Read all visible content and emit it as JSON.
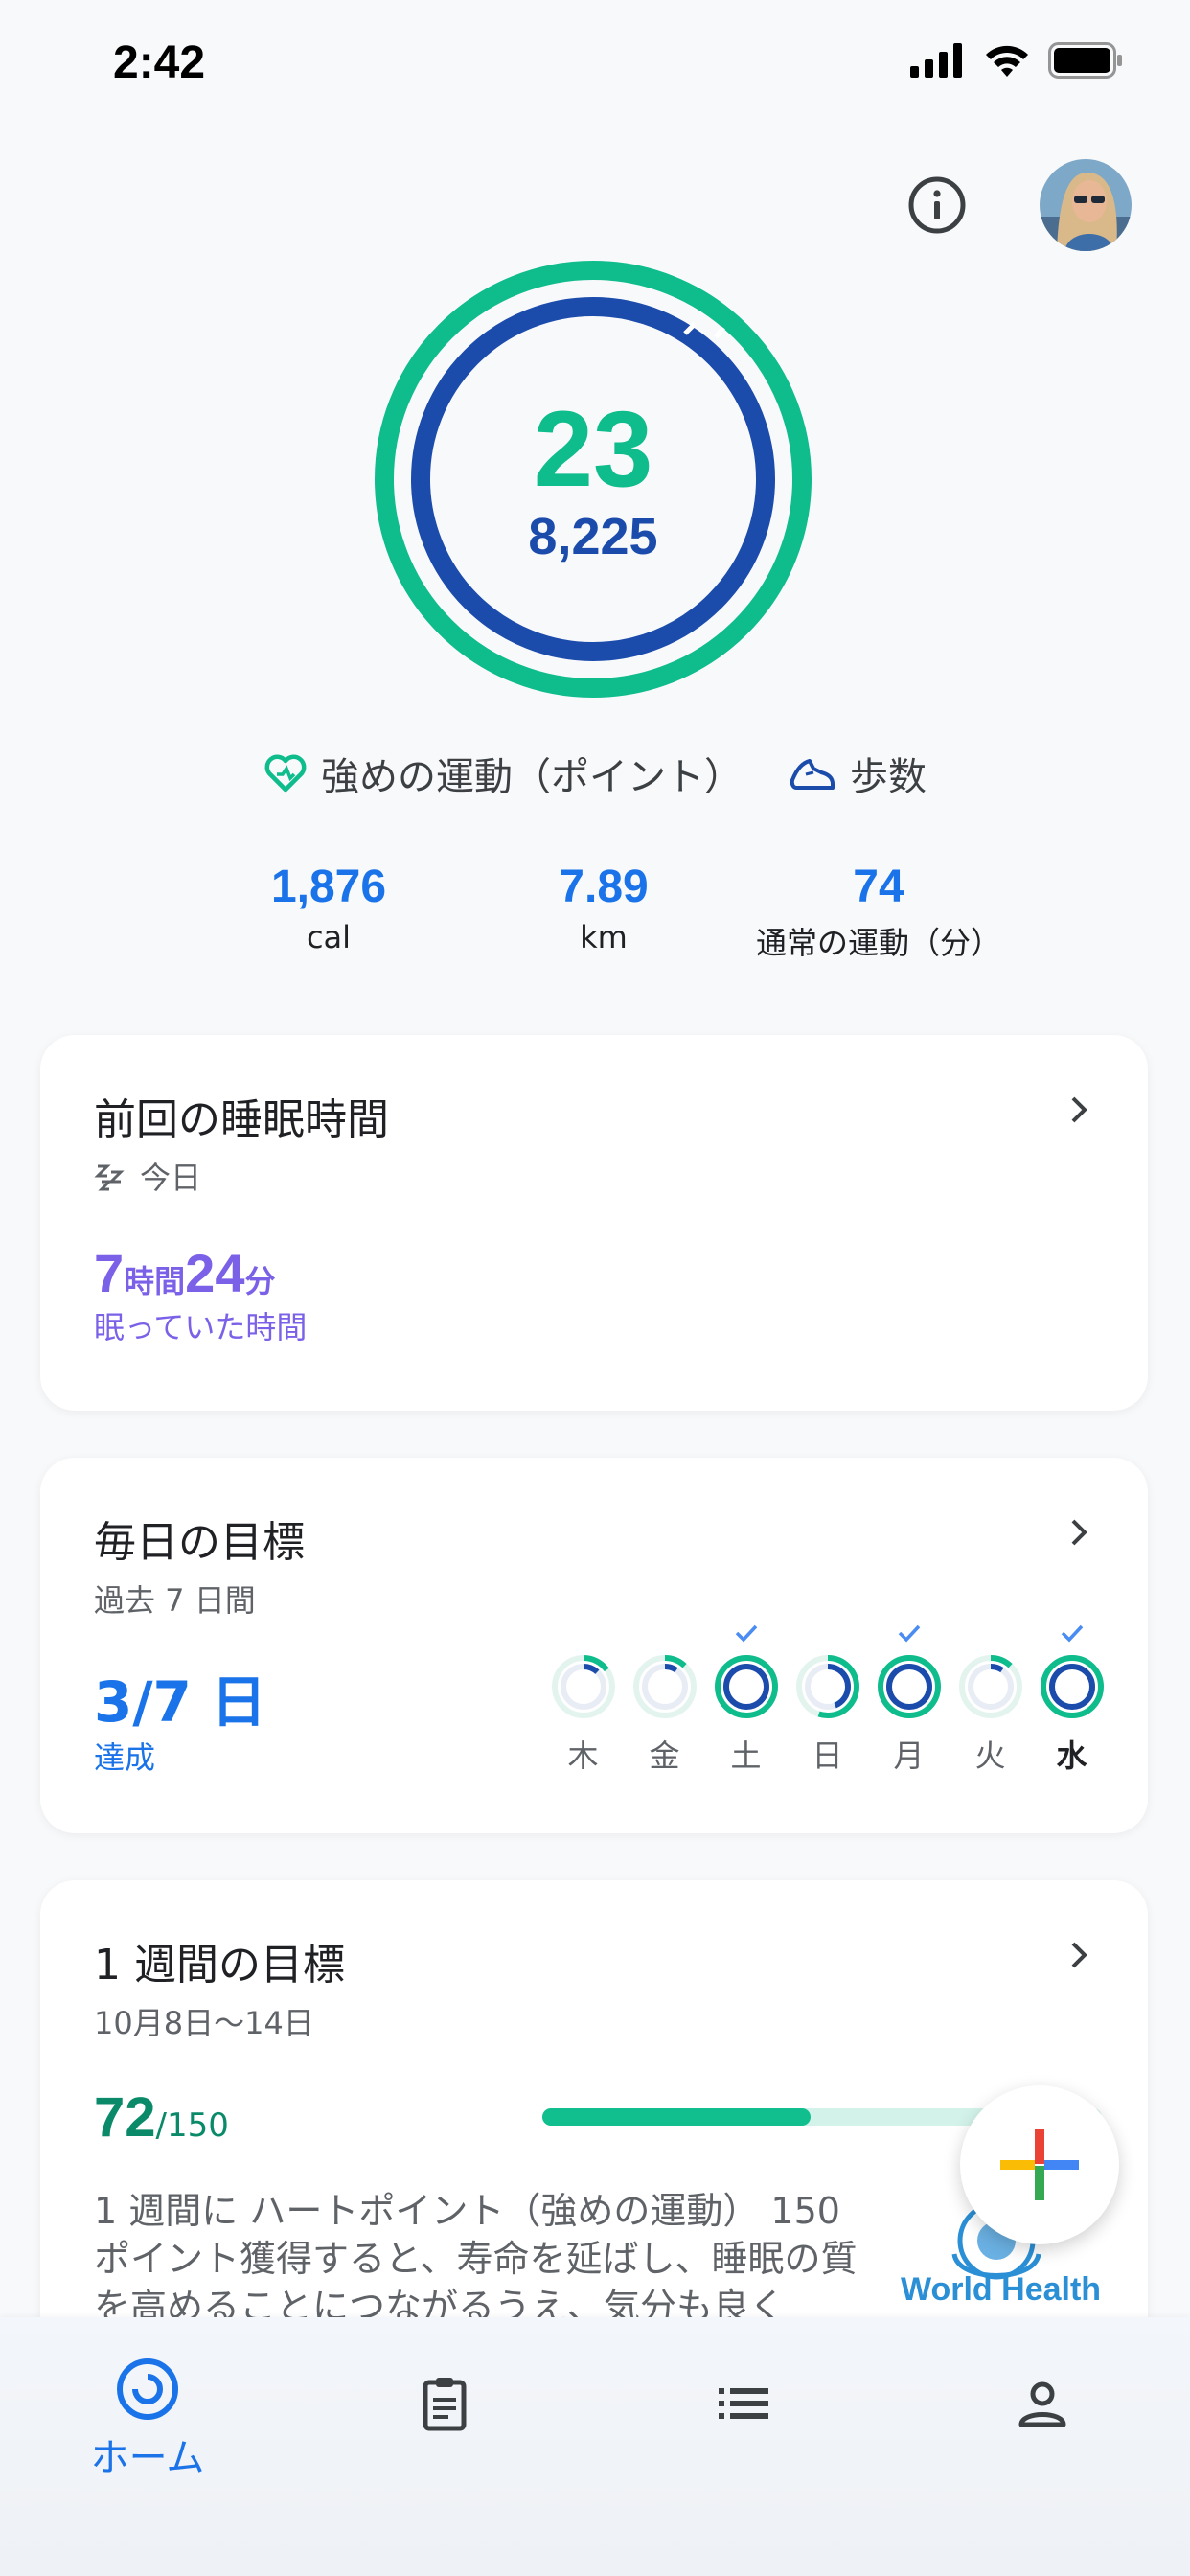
{
  "status_bar": {
    "time": "2:42"
  },
  "rings": {
    "heart_points": "23",
    "steps": "8,225",
    "heart_color": "#0fbc8c",
    "steps_color": "#1b4bab"
  },
  "legend": {
    "heart_label": "強めの運動（ポイント）",
    "steps_label": "歩数"
  },
  "stats": [
    {
      "value": "1,876",
      "unit": "cal"
    },
    {
      "value": "7.89",
      "unit": "km"
    },
    {
      "value": "74",
      "unit": "通常の運動（分）"
    }
  ],
  "sleep_card": {
    "title": "前回の睡眠時間",
    "subtitle": "今日",
    "hours": "7",
    "hours_unit": "時間",
    "minutes": "24",
    "minutes_unit": "分",
    "label": "眠っていた時間"
  },
  "daily_card": {
    "title": "毎日の目標",
    "subtitle": "過去 7 日間",
    "achieved": "3/7 日",
    "label": "達成",
    "days": [
      {
        "label": "木",
        "progress": 0.15,
        "met": false,
        "today": false
      },
      {
        "label": "金",
        "progress": 0.12,
        "met": false,
        "today": false
      },
      {
        "label": "土",
        "progress": 1.0,
        "met": true,
        "today": false
      },
      {
        "label": "日",
        "progress": 0.55,
        "met": false,
        "today": false
      },
      {
        "label": "月",
        "progress": 1.0,
        "met": true,
        "today": false
      },
      {
        "label": "火",
        "progress": 0.12,
        "met": false,
        "today": false
      },
      {
        "label": "水",
        "progress": 1.0,
        "met": true,
        "today": true
      }
    ]
  },
  "weekly_card": {
    "title": "1 週間の目標",
    "subtitle": "10月8日〜14日",
    "value": "72",
    "target": "/150",
    "progress": 0.48,
    "description": "1 週間に ハートポイント（強めの運動） 150 ポイント獲得すると、寿命を延ばし、睡眠の質を高めることにつながるうえ、気分も良く",
    "partner_text": "World Health"
  },
  "bottom_nav": {
    "home_label": "ホーム",
    "items": [
      "home",
      "journal",
      "browse",
      "profile"
    ]
  },
  "icons": {
    "info": "info-icon",
    "avatar": "profile-avatar",
    "fab": "add-icon"
  }
}
